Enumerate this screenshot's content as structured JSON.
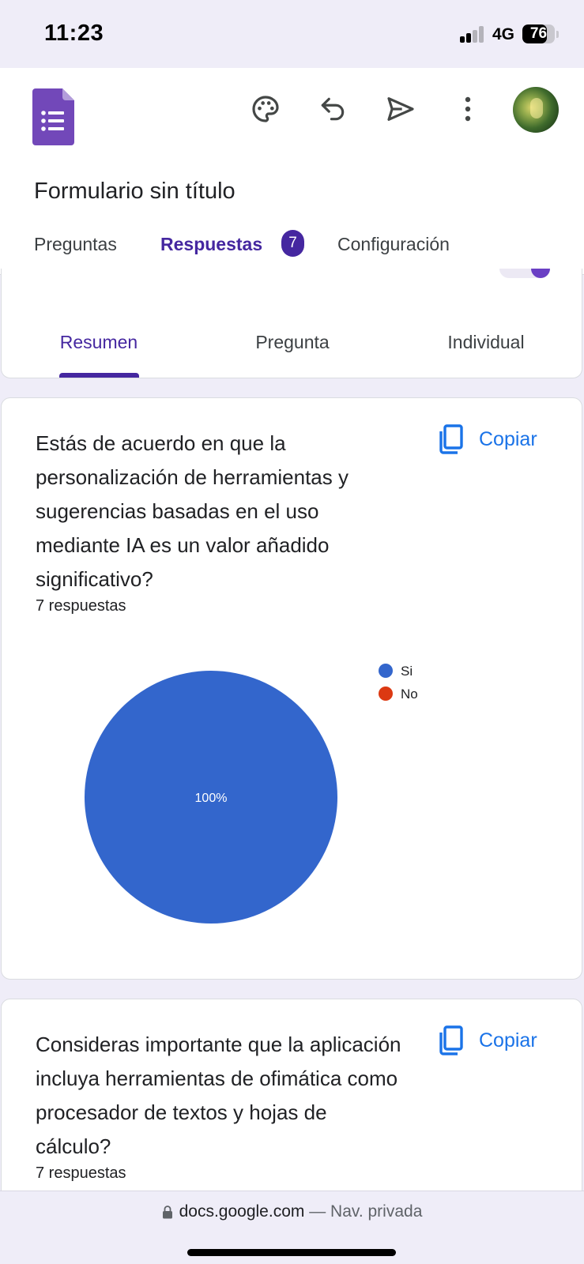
{
  "status_bar": {
    "time": "11:23",
    "network": "4G",
    "battery": "76",
    "battery_level": 0.76
  },
  "header": {
    "form_title": "Formulario sin título",
    "icons": [
      "forms-logo-icon",
      "palette-icon",
      "undo-icon",
      "send-icon",
      "more-vert-icon",
      "avatar"
    ],
    "tabs": [
      {
        "label": "Preguntas",
        "active": false
      },
      {
        "label": "Respuestas",
        "active": true,
        "badge": "7"
      },
      {
        "label": "Configuración",
        "active": false
      }
    ]
  },
  "subtabs": [
    {
      "label": "Resumen",
      "active": true
    },
    {
      "label": "Pregunta",
      "active": false
    },
    {
      "label": "Individual",
      "active": false
    }
  ],
  "questions": [
    {
      "title": "Estás de acuerdo en que la personalización de herramientas y sugerencias basadas en el uso mediante IA es un valor añadido significativo?",
      "responses": "7 respuestas",
      "copy_label": "Copiar"
    },
    {
      "title": "Consideras importante que la aplicación incluya herramientas de ofimática como procesador de textos y hojas de cálculo?",
      "responses": "7 respuestas",
      "copy_label": "Copiar"
    }
  ],
  "chart_data": {
    "type": "pie",
    "categories": [
      "Si",
      "No"
    ],
    "values": [
      100,
      0
    ],
    "data_labels": [
      "100%",
      ""
    ],
    "colors": [
      "#3366cc",
      "#dc3912"
    ],
    "legend_position": "right"
  },
  "colors": {
    "accent": "#4527a0",
    "link": "#1a73e8",
    "forms_purple": "#7248b9"
  },
  "bottom_bar": {
    "domain": "docs.google.com",
    "separator": " — ",
    "mode": "Nav. privada"
  }
}
